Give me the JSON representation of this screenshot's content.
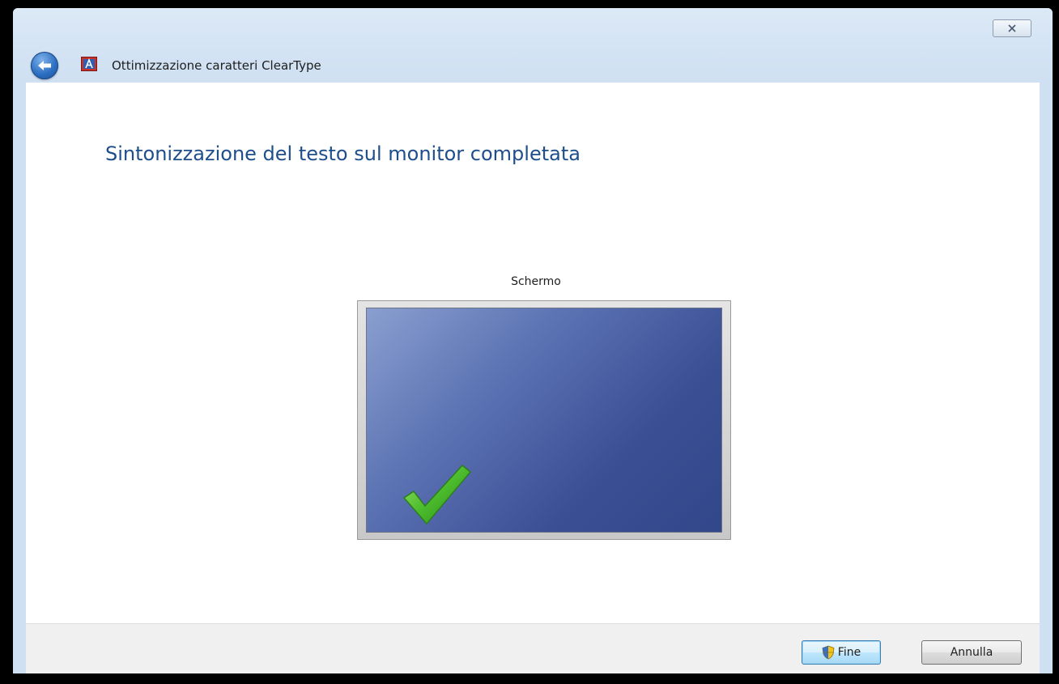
{
  "window": {
    "title": "Ottimizzazione caratteri ClearType",
    "icons": {
      "back": "back-arrow-icon",
      "app": "cleartype-icon",
      "close": "close-icon"
    }
  },
  "main": {
    "heading": "Sintonizzazione del testo sul monitor completata",
    "monitor_label": "Schermo",
    "status_icon": "checkmark-icon"
  },
  "footer": {
    "finish_label": "Fine",
    "finish_icon": "uac-shield-icon",
    "cancel_label": "Annulla"
  },
  "colors": {
    "heading": "#1e4e8c",
    "screen": "#3b4f94",
    "check": "#4cbb2c"
  }
}
